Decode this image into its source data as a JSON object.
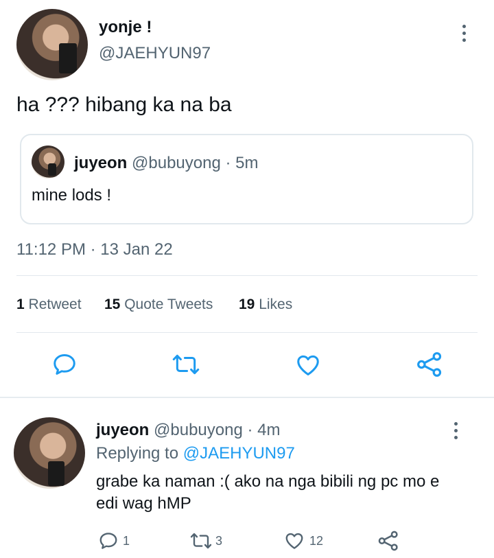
{
  "tweet": {
    "author_name": "yonje !",
    "author_handle": "@JAEHYUN97",
    "text": "ha ??? hibang ka na ba",
    "quote": {
      "name": "juyeon",
      "handle": "@bubuyong",
      "time": "· 5m",
      "text": "mine lods !"
    },
    "timestamp": "11:12 PM · 13 Jan 22",
    "stats": {
      "retweets_count": "1",
      "retweets_label": "Retweet",
      "quotes_count": "15",
      "quotes_label": "Quote Tweets",
      "likes_count": "19",
      "likes_label": "Likes"
    }
  },
  "reply": {
    "name": "juyeon",
    "handle": "@bubuyong",
    "time": "· 4m",
    "replying_prefix": "Replying to",
    "replying_handle": "@JAEHYUN97",
    "text_line1": "grabe ka naman :( ako na nga bibili ng pc mo e",
    "text_line2": "edi wag hMP",
    "replies_count": "1",
    "retweets_count": "3",
    "likes_count": "12"
  },
  "icons": {
    "more": "more-vertical-icon",
    "reply": "reply-icon",
    "retweet": "retweet-icon",
    "like": "heart-icon",
    "share": "share-icon"
  },
  "colors": {
    "link": "#1d9bf0",
    "muted": "#536471",
    "text": "#0f1419"
  }
}
